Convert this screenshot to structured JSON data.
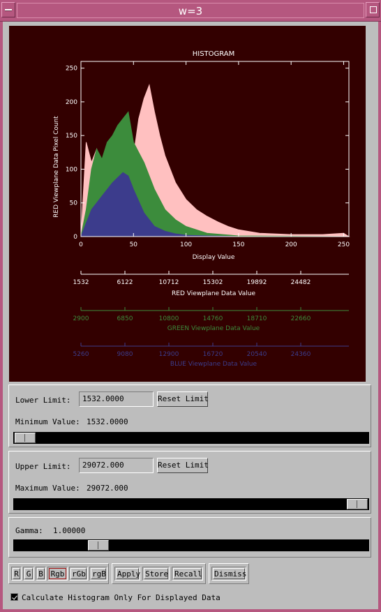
{
  "window": {
    "title": "w=3"
  },
  "histogram": {
    "title": "HISTOGRAM",
    "ylabel": "RED Viewplane Data Pixel Count",
    "xlabel": "Display Value",
    "xticks": [
      "0",
      "50",
      "100",
      "150",
      "200",
      "250"
    ],
    "yticks": [
      "0",
      "50",
      "100",
      "150",
      "200",
      "250"
    ],
    "red_axis": {
      "label": "RED Viewplane Data Value",
      "ticks": [
        "1532",
        "6122",
        "10712",
        "15302",
        "19892",
        "24482"
      ],
      "color": "#ffffff"
    },
    "green_axis": {
      "label": "GREEN Viewplane Data Value",
      "ticks": [
        "2900",
        "6850",
        "10800",
        "14760",
        "18710",
        "22660"
      ],
      "color": "#3c8c3c"
    },
    "blue_axis": {
      "label": "BLUE Viewplane Data Value",
      "ticks": [
        "5260",
        "9080",
        "12900",
        "16720",
        "20540",
        "24360"
      ],
      "color": "#3c3c8c"
    },
    "colors": {
      "red": "#ffc0c0",
      "green": "#3c8c3c",
      "blue": "#3c3c8c",
      "background": "#330000"
    }
  },
  "chart_data": {
    "type": "area",
    "title": "HISTOGRAM",
    "xlabel": "Display Value",
    "ylabel": "RED Viewplane Data Pixel Count",
    "xlim": [
      0,
      255
    ],
    "ylim": [
      0,
      260
    ],
    "grid": false,
    "series": [
      {
        "color": "#3c3c8c",
        "x": [
          0,
          5,
          10,
          20,
          30,
          40,
          45,
          50,
          60,
          70,
          80,
          90,
          100,
          120,
          150,
          255
        ],
        "values": [
          0,
          20,
          40,
          60,
          80,
          95,
          90,
          70,
          35,
          15,
          8,
          4,
          2,
          1,
          0,
          0
        ]
      },
      {
        "color": "#3c8c3c",
        "x": [
          0,
          5,
          10,
          15,
          20,
          25,
          30,
          35,
          40,
          45,
          50,
          55,
          60,
          70,
          80,
          90,
          100,
          120,
          150,
          255
        ],
        "values": [
          0,
          40,
          100,
          130,
          115,
          140,
          150,
          165,
          175,
          185,
          140,
          125,
          110,
          70,
          40,
          25,
          15,
          5,
          1,
          0
        ]
      },
      {
        "color": "#ffc0c0",
        "x": [
          0,
          5,
          10,
          15,
          20,
          30,
          40,
          45,
          50,
          55,
          60,
          65,
          70,
          75,
          80,
          90,
          100,
          110,
          120,
          130,
          140,
          150,
          170,
          200,
          230,
          250,
          255
        ],
        "values": [
          0,
          140,
          110,
          130,
          110,
          120,
          125,
          115,
          120,
          175,
          205,
          225,
          185,
          150,
          120,
          80,
          55,
          40,
          30,
          22,
          15,
          10,
          5,
          3,
          3,
          5,
          0
        ]
      }
    ]
  },
  "lower": {
    "label": "Lower Limit:",
    "value": "1532.0000",
    "reset": "Reset Limit",
    "min_label": "Minimum Value:",
    "min_value": "1532.0000",
    "slider_level": 0.0
  },
  "upper": {
    "label": "Upper Limit:",
    "value": "29072.000",
    "reset": "Reset Limit",
    "max_label": "Maximum Value:",
    "max_value": "29072.000",
    "slider_level": 1.0
  },
  "gamma": {
    "label": "Gamma:",
    "value": "1.00000",
    "slider_level": 0.22
  },
  "modes": [
    "R",
    "G",
    "B",
    "Rgb",
    "rGb",
    "rgB"
  ],
  "active_mode": "Rgb",
  "actions": {
    "apply": "Apply",
    "store": "Store",
    "recall": "Recall",
    "dismiss": "Dismiss"
  },
  "option": {
    "label": "Calculate Histogram Only For Displayed Data",
    "checked": true
  }
}
